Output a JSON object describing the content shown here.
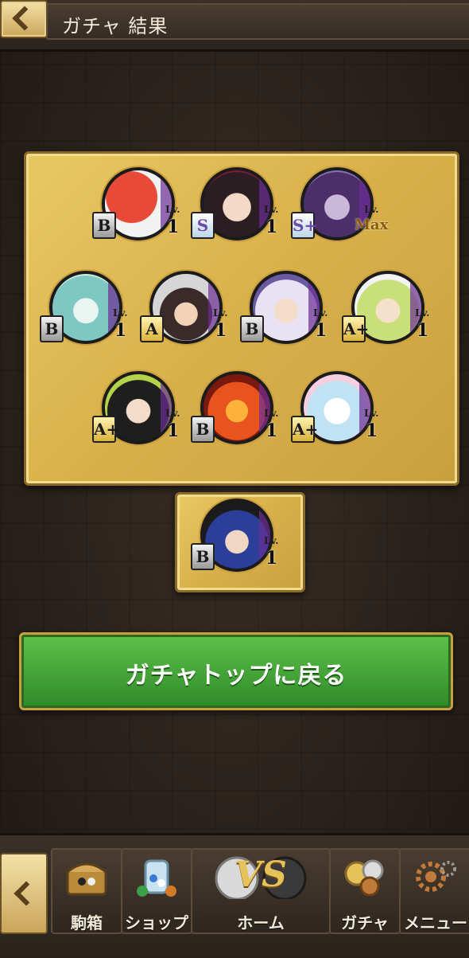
{
  "header": {
    "title": "ガチャ 結果"
  },
  "results": [
    {
      "rank": "B",
      "rank_class": "b",
      "lv_label": "Lv.",
      "lv": "1",
      "colors": [
        "#e84a3a",
        "#f2f2f2"
      ]
    },
    {
      "rank": "S",
      "rank_class": "s",
      "lv_label": "Lv.",
      "lv": "1",
      "colors": [
        "#2a1e22",
        "#7a1d3a"
      ]
    },
    {
      "rank": "S+",
      "rank_class": "sp",
      "lv_label": "Lv.",
      "lv": "Max",
      "colors": [
        "#4b2e6a",
        "#8a6fb0"
      ]
    },
    {
      "rank": "B",
      "rank_class": "b",
      "lv_label": "Lv.",
      "lv": "1",
      "colors": [
        "#7fc7c2",
        "#c8ecd9"
      ]
    },
    {
      "rank": "A",
      "rank_class": "a",
      "lv_label": "Lv.",
      "lv": "1",
      "colors": [
        "#d6d6d6",
        "#3a2a2a"
      ]
    },
    {
      "rank": "B",
      "rank_class": "b",
      "lv_label": "Lv.",
      "lv": "1",
      "colors": [
        "#e8e2f2",
        "#6a5aa0"
      ]
    },
    {
      "rank": "A+",
      "rank_class": "ap",
      "lv_label": "Lv.",
      "lv": "1",
      "colors": [
        "#c9e07a",
        "#f2f2f2"
      ]
    },
    {
      "rank": "A+",
      "rank_class": "ap",
      "lv_label": "Lv.",
      "lv": "1",
      "colors": [
        "#1e1e1e",
        "#b4d24a"
      ]
    },
    {
      "rank": "B",
      "rank_class": "b",
      "lv_label": "Lv.",
      "lv": "1",
      "colors": [
        "#e8531e",
        "#7a1a0e"
      ]
    },
    {
      "rank": "A+",
      "rank_class": "ap",
      "lv_label": "Lv.",
      "lv": "1",
      "colors": [
        "#bfe3f5",
        "#f5cfe0"
      ]
    },
    {
      "rank": "B",
      "rank_class": "b",
      "lv_label": "Lv.",
      "lv": "1",
      "colors": [
        "#2a3e9a",
        "#1b1b1b"
      ]
    }
  ],
  "return_button": {
    "label": "ガチャトップに戻る"
  },
  "nav": {
    "items": [
      {
        "label": "駒箱",
        "icon": "treasure-chest-icon"
      },
      {
        "label": "ショップ",
        "icon": "shop-jar-icon"
      },
      {
        "label": "ホーム",
        "icon": "vs-home-icon",
        "vs_text": "VS"
      },
      {
        "label": "ガチャ",
        "icon": "gacha-coins-icon"
      },
      {
        "label": "メニュー",
        "icon": "gears-menu-icon"
      }
    ]
  }
}
